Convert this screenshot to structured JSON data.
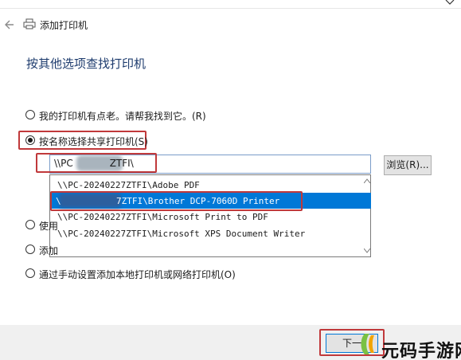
{
  "window": {
    "title": "添加打印机"
  },
  "page": {
    "heading": "按其他选项查找打印机"
  },
  "options": [
    {
      "label": "我的打印机有点老。请帮我找到它。(R)",
      "checked": false
    },
    {
      "label": "按名称选择共享打印机(S)",
      "checked": true
    },
    {
      "label": "使用",
      "checked": false
    },
    {
      "label": "添加",
      "checked": false
    },
    {
      "label": "通过手动设置添加本地打印机或网络打印机(O)",
      "checked": false
    }
  ],
  "path_input": {
    "value_start": "\\\\PC",
    "value_end": "ZTFI\\"
  },
  "browse_button": {
    "label": "浏览(R)..."
  },
  "dropdown": {
    "items": [
      "\\\\PC-20240227ZTFI\\Adobe PDF",
      "7ZTFI\\Brother DCP-7060D Printer",
      "\\\\PC-20240227ZTFI\\Microsoft Print to PDF",
      "\\\\PC-20240227ZTFI\\Microsoft XPS Document Writer"
    ],
    "selected_index": 1,
    "selected_prefix": "\\"
  },
  "next_button": {
    "label": "下一"
  },
  "watermark": {
    "text": "元码手游网"
  },
  "colors": {
    "accent": "#0078d7",
    "highlight": "#c0393b",
    "heading": "#1e3c6e"
  },
  "icons": [
    "back-arrow-icon",
    "printer-icon",
    "close-icon",
    "scroll-up-icon",
    "scroll-down-icon"
  ]
}
